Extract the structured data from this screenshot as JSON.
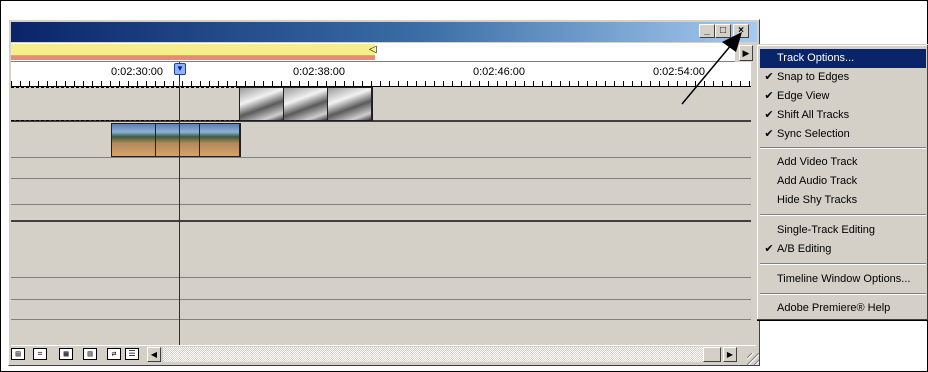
{
  "window": {
    "title": "",
    "minimize_glyph": "_",
    "maximize_glyph": "□",
    "close_glyph": "×"
  },
  "ruler": {
    "marks": [
      "0:02:30:00",
      "0:02:38:00",
      "0:02:46:00",
      "0:02:54:00"
    ]
  },
  "work_area": {
    "marker_glyph": "◁",
    "menu_button_glyph": "▶"
  },
  "toolbar": {
    "icons": [
      "track-format-icon",
      "toggle-snap-icon",
      "edge-view-icon",
      "shift-tracks-icon",
      "sync-icon",
      "toggle-icon"
    ],
    "glyphs": [
      "▤",
      "⌗",
      "▦",
      "▥",
      "⇄",
      "☰"
    ]
  },
  "scrollbar": {
    "left_glyph": "◀",
    "right_glyph": "▶"
  },
  "menu": {
    "items": [
      {
        "label": "Track Options...",
        "checked": false,
        "highlighted": true
      },
      {
        "label": "Snap to Edges",
        "checked": true
      },
      {
        "label": "Edge View",
        "checked": true
      },
      {
        "label": "Shift All Tracks",
        "checked": true
      },
      {
        "label": "Sync Selection",
        "checked": true
      },
      {
        "label": "Add Video Track",
        "checked": false
      },
      {
        "label": "Add Audio Track",
        "checked": false
      },
      {
        "label": "Hide Shy Tracks",
        "checked": false
      },
      {
        "label": "Single-Track Editing",
        "checked": false
      },
      {
        "label": "A/B Editing",
        "checked": true
      },
      {
        "label": "Timeline Window Options...",
        "checked": false
      },
      {
        "label": "Adobe Premiere® Help",
        "checked": false
      }
    ],
    "check_glyph": "✔"
  },
  "colors": {
    "title_gradient_start": "#0a246a",
    "title_gradient_end": "#a6caf0",
    "highlight": "#0a246a",
    "work_area_yellow": "#f5ee8c",
    "work_area_red": "#e88a7a"
  }
}
